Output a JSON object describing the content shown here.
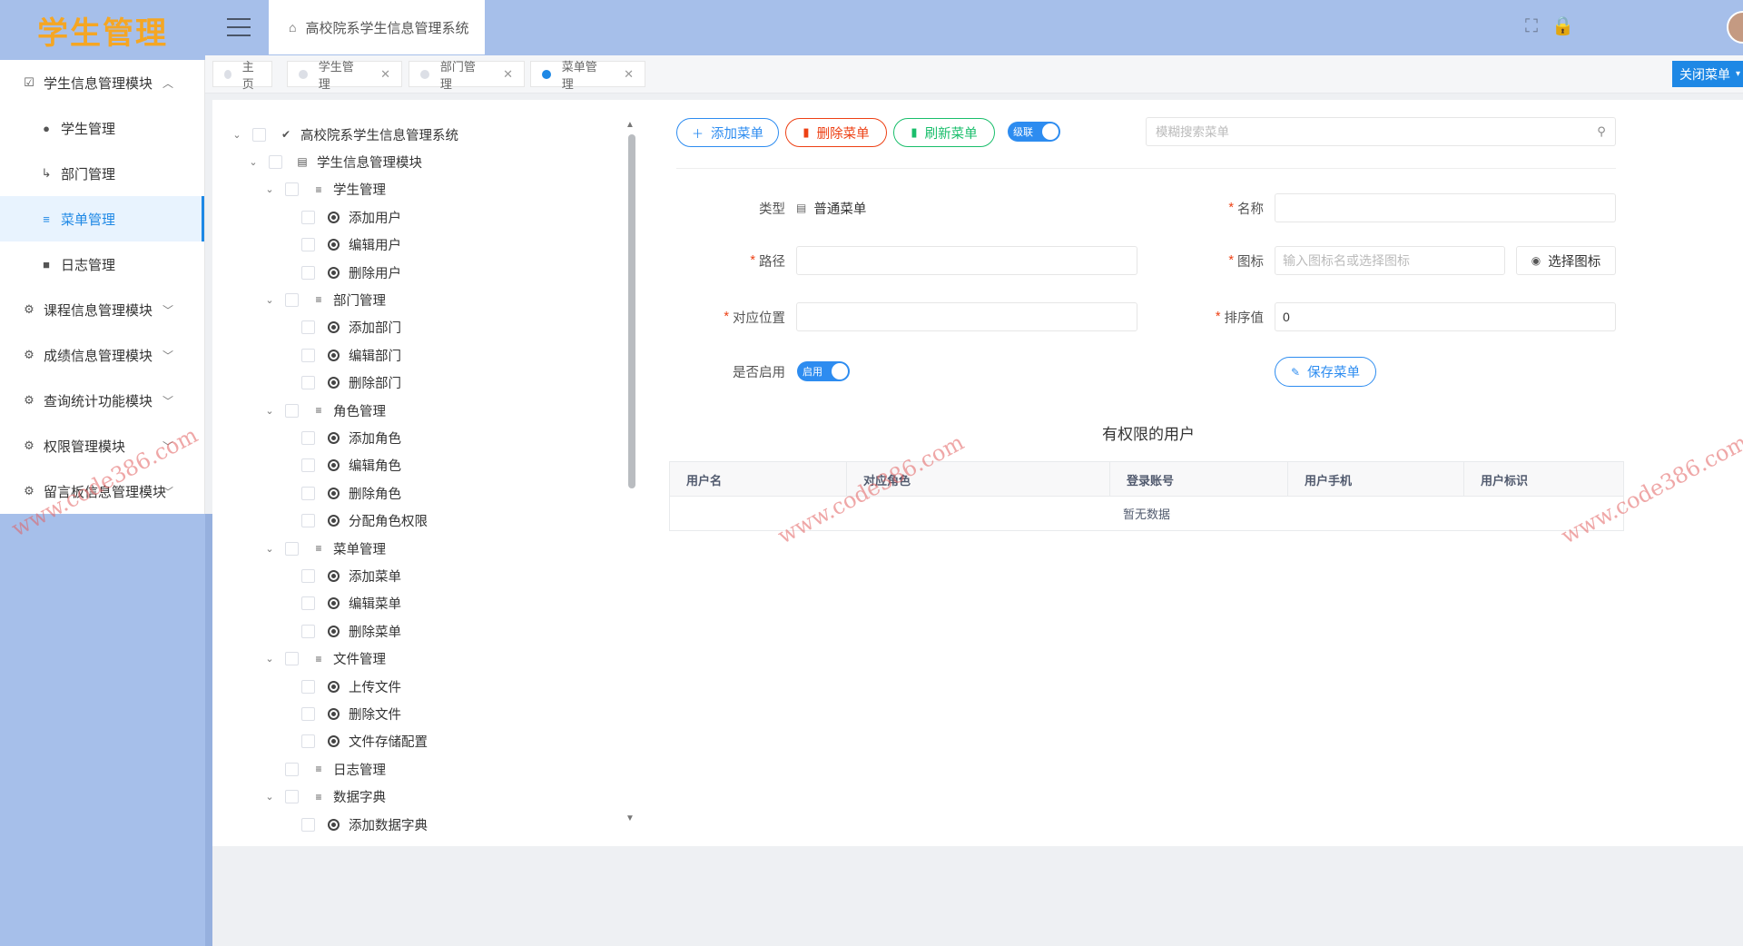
{
  "app": {
    "logo": "学生管理",
    "breadcrumb": "高校院系学生信息管理系统"
  },
  "tabs": [
    {
      "label": "主页",
      "closable": false,
      "active": false
    },
    {
      "label": "学生管理",
      "closable": true,
      "active": false
    },
    {
      "label": "部门管理",
      "closable": true,
      "active": false
    },
    {
      "label": "菜单管理",
      "closable": true,
      "active": true
    }
  ],
  "close_menu_label": "关闭菜单",
  "sidebar": {
    "items": [
      {
        "label": "学生信息管理模块",
        "level": "top",
        "expanded": true,
        "icon": "checkbox-icon"
      },
      {
        "label": "学生管理",
        "level": "sub",
        "icon": "user-icon"
      },
      {
        "label": "部门管理",
        "level": "sub",
        "icon": "dept-icon"
      },
      {
        "label": "菜单管理",
        "level": "sub",
        "icon": "menu-icon",
        "active": true
      },
      {
        "label": "日志管理",
        "level": "sub",
        "icon": "log-icon"
      },
      {
        "label": "课程信息管理模块",
        "level": "top",
        "expanded": false,
        "icon": "gear-icon"
      },
      {
        "label": "成绩信息管理模块",
        "level": "top",
        "expanded": false,
        "icon": "gear-icon"
      },
      {
        "label": "查询统计功能模块",
        "level": "top",
        "expanded": false,
        "icon": "gear-icon"
      },
      {
        "label": "权限管理模块",
        "level": "top",
        "expanded": false,
        "icon": "gear-icon"
      },
      {
        "label": "留言板信息管理模块",
        "level": "top",
        "expanded": false,
        "icon": "gear-icon"
      }
    ]
  },
  "tree": {
    "nodes": [
      {
        "label": "高校院系学生信息管理系统",
        "depth": 0,
        "kind": "root",
        "expandable": true
      },
      {
        "label": "学生信息管理模块",
        "depth": 1,
        "kind": "module",
        "expandable": true
      },
      {
        "label": "学生管理",
        "depth": 2,
        "kind": "menu",
        "expandable": true
      },
      {
        "label": "添加用户",
        "depth": 3,
        "kind": "button",
        "expandable": false
      },
      {
        "label": "编辑用户",
        "depth": 3,
        "kind": "button",
        "expandable": false
      },
      {
        "label": "删除用户",
        "depth": 3,
        "kind": "button",
        "expandable": false
      },
      {
        "label": "部门管理",
        "depth": 2,
        "kind": "menu",
        "expandable": true
      },
      {
        "label": "添加部门",
        "depth": 3,
        "kind": "button",
        "expandable": false
      },
      {
        "label": "编辑部门",
        "depth": 3,
        "kind": "button",
        "expandable": false
      },
      {
        "label": "删除部门",
        "depth": 3,
        "kind": "button",
        "expandable": false
      },
      {
        "label": "角色管理",
        "depth": 2,
        "kind": "menu",
        "expandable": true
      },
      {
        "label": "添加角色",
        "depth": 3,
        "kind": "button",
        "expandable": false
      },
      {
        "label": "编辑角色",
        "depth": 3,
        "kind": "button",
        "expandable": false
      },
      {
        "label": "删除角色",
        "depth": 3,
        "kind": "button",
        "expandable": false
      },
      {
        "label": "分配角色权限",
        "depth": 3,
        "kind": "button",
        "expandable": false
      },
      {
        "label": "菜单管理",
        "depth": 2,
        "kind": "menu",
        "expandable": true
      },
      {
        "label": "添加菜单",
        "depth": 3,
        "kind": "button",
        "expandable": false
      },
      {
        "label": "编辑菜单",
        "depth": 3,
        "kind": "button",
        "expandable": false
      },
      {
        "label": "删除菜单",
        "depth": 3,
        "kind": "button",
        "expandable": false
      },
      {
        "label": "文件管理",
        "depth": 2,
        "kind": "menu",
        "expandable": true
      },
      {
        "label": "上传文件",
        "depth": 3,
        "kind": "button",
        "expandable": false
      },
      {
        "label": "删除文件",
        "depth": 3,
        "kind": "button",
        "expandable": false
      },
      {
        "label": "文件存储配置",
        "depth": 3,
        "kind": "button",
        "expandable": false
      },
      {
        "label": "日志管理",
        "depth": 2,
        "kind": "menu",
        "expandable": false
      },
      {
        "label": "数据字典",
        "depth": 2,
        "kind": "menu",
        "expandable": true
      },
      {
        "label": "添加数据字典",
        "depth": 3,
        "kind": "button",
        "expandable": false
      }
    ]
  },
  "toolbar": {
    "add_label": "添加菜单",
    "delete_label": "删除菜单",
    "refresh_label": "刷新菜单",
    "cascade_label": "级联",
    "cascade_on": true,
    "search_placeholder": "模糊搜索菜单"
  },
  "form": {
    "type_label": "类型",
    "type_value": "普通菜单",
    "name_label": "名称",
    "name_value": "",
    "path_label": "路径",
    "path_value": "",
    "icon_label": "图标",
    "icon_placeholder": "输入图标名或选择图标",
    "pick_icon_label": "选择图标",
    "position_label": "对应位置",
    "position_value": "",
    "sort_label": "排序值",
    "sort_value": "0",
    "enabled_label": "是否启用",
    "enabled_toggle_label": "启用",
    "enabled": true,
    "save_label": "保存菜单"
  },
  "users_table": {
    "title": "有权限的用户",
    "columns": [
      "用户名",
      "对应角色",
      "登录账号",
      "用户手机",
      "用户标识"
    ],
    "empty_text": "暂无数据"
  },
  "watermarks": [
    "www.code386.com",
    "www.code386.com",
    "www.code386.com"
  ],
  "colors": {
    "header_bg": "#a6bfea",
    "logo": "#f5a623",
    "primary": "#2d8cf0",
    "danger": "#ed4014",
    "success": "#19be6b"
  }
}
